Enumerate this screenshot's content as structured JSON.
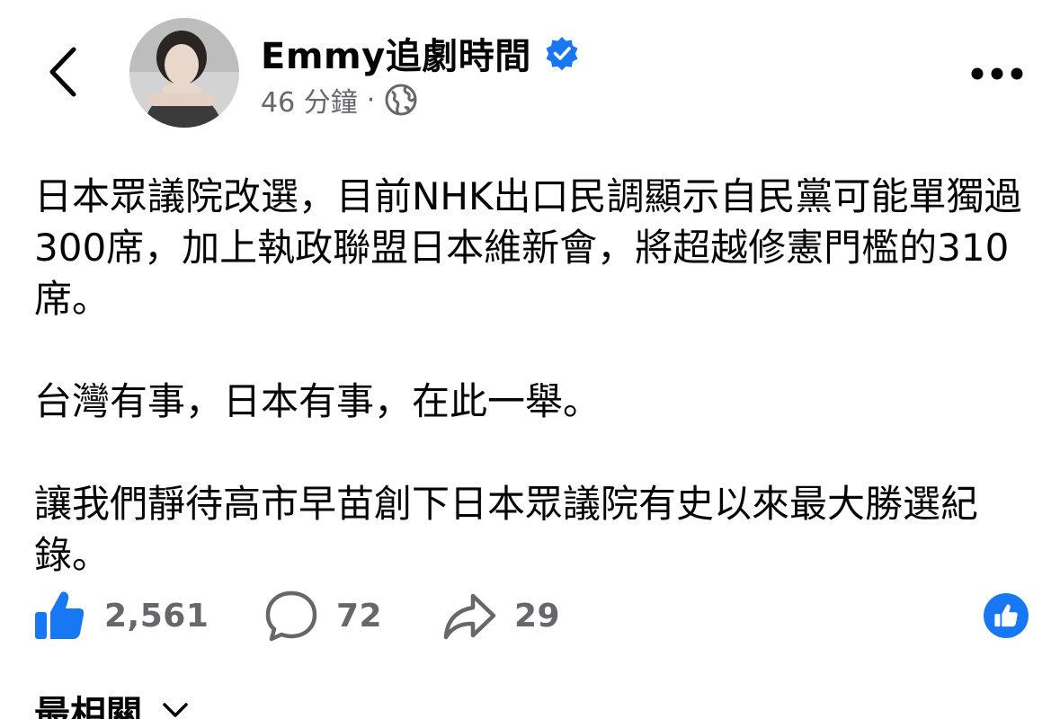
{
  "header": {
    "author_name": "Emmy追劇時間",
    "timestamp": "46 分鐘",
    "separator": "·",
    "audience_icon": "globe-icon",
    "verified_icon": "verified-badge-icon",
    "back_icon": "chevron-left-icon",
    "more_icon": "more-horizontal-icon"
  },
  "post": {
    "paragraphs": [
      "日本眾議院改選，目前NHK出口民調顯示自民黨可能單獨過300席，加上執政聯盟日本維新會，將超越修憲門檻的310席。",
      "台灣有事，日本有事，在此一舉。",
      "讓我們靜待高市早苗創下日本眾議院有史以來最大勝選紀錄。"
    ]
  },
  "reactions": {
    "likes": "2,561",
    "comments": "72",
    "shares": "29",
    "like_icon": "thumbs-up-icon",
    "comment_icon": "comment-bubble-icon",
    "share_icon": "share-arrow-icon"
  },
  "comments": {
    "sort_label": "最相關",
    "sort_icon": "chevron-down-icon"
  },
  "colors": {
    "accent": "#1877f2",
    "secondary_text": "#65676b",
    "primary_text": "#050505"
  }
}
